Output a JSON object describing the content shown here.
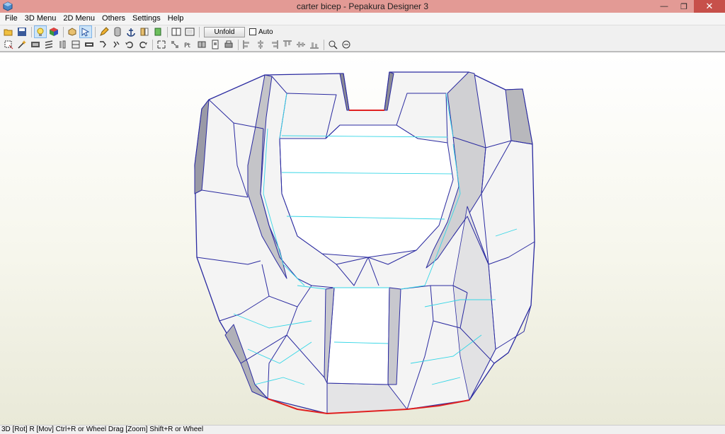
{
  "window": {
    "title": "carter bicep - Pepakura Designer 3"
  },
  "menubar": {
    "items": [
      "File",
      "3D Menu",
      "2D Menu",
      "Others",
      "Settings",
      "Help"
    ]
  },
  "toolbar1": {
    "icons_left": [
      "open-folder-icon",
      "save-icon",
      "lightbulb-icon",
      "texture-cube-icon",
      "rotate-cube-icon",
      "select-arrow-icon",
      "pencil-icon",
      "cylinder-icon",
      "anchor-icon",
      "flip-icon",
      "move-part-icon",
      "single-window-icon",
      "dual-window-icon"
    ],
    "unfold_label": "Unfold",
    "auto_label": "Auto"
  },
  "toolbar2": {
    "icons": [
      "select-edge-icon",
      "magic-wand-icon",
      "image-icon",
      "stripes-icon",
      "fold-icon",
      "flap-icon",
      "cut-icon",
      "rotate-left-icon",
      "rotate-right-icon",
      "undo-icon",
      "redo-icon",
      "zoom-fit-icon",
      "arrange-icon",
      "join-icon",
      "split-icon",
      "print-icon",
      "align-left-icon",
      "align-center-icon",
      "align-right-icon",
      "align-top-icon",
      "align-middle-icon",
      "align-bottom-icon",
      "zoom-in-icon",
      "zoom-out-icon"
    ]
  },
  "statusbar": {
    "text": "3D [Rot] R [Mov] Ctrl+R or Wheel Drag [Zoom] Shift+R or Wheel"
  },
  "colors": {
    "title_bg": "#e39a95",
    "close_bg": "#c7504a",
    "edge_blue": "#2a2aa0",
    "edge_cyan": "#35d6e6",
    "edge_red": "#e02020"
  }
}
